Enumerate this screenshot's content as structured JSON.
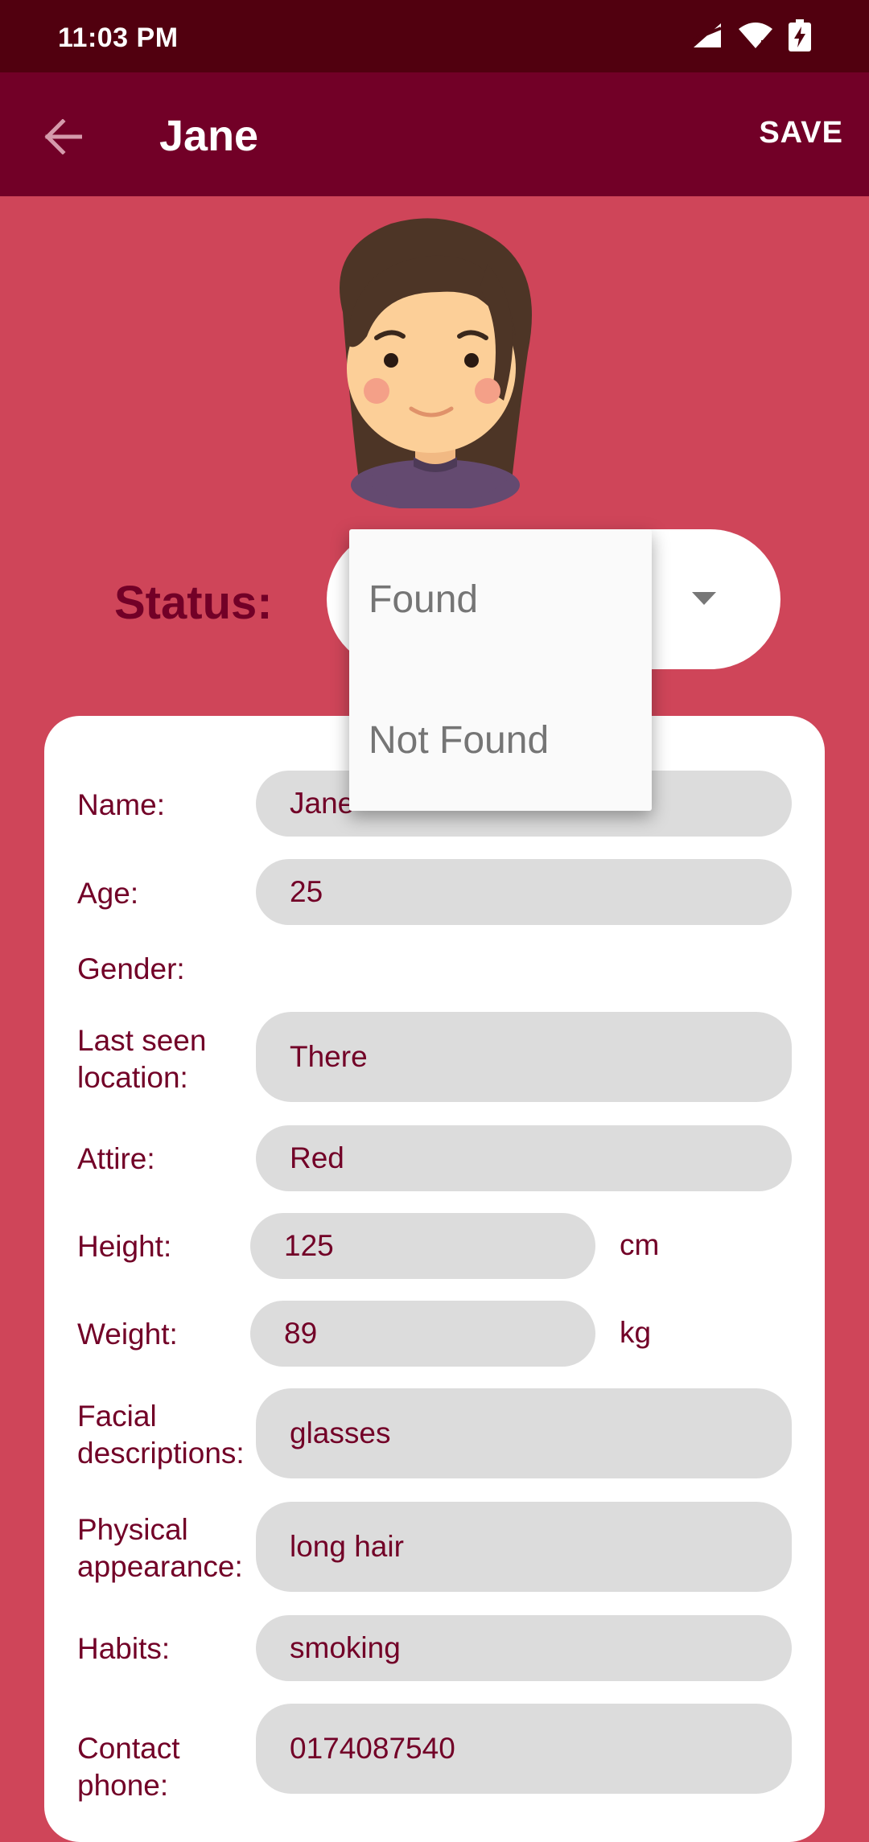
{
  "status_bar": {
    "time": "11:03 PM"
  },
  "app_bar": {
    "title": "Jane",
    "save_label": "SAVE"
  },
  "status": {
    "label": "Status:",
    "selected": "Found",
    "options": [
      "Found",
      "Not Found"
    ]
  },
  "form": {
    "name": {
      "label": "Name:",
      "value": "Jane"
    },
    "age": {
      "label": "Age:",
      "value": "25"
    },
    "gender": {
      "label": "Gender:"
    },
    "last_seen": {
      "label_line1": "Last seen",
      "label_line2": "location:",
      "value": "There"
    },
    "attire": {
      "label": "Attire:",
      "value": "Red"
    },
    "height": {
      "label": "Height:",
      "value": "125",
      "unit": "cm"
    },
    "weight": {
      "label": "Weight:",
      "value": "89",
      "unit": "kg"
    },
    "facial": {
      "label_line1": "Facial",
      "label_line2": "descriptions:",
      "value": "glasses"
    },
    "physical": {
      "label_line1": "Physical",
      "label_line2": "appearance:",
      "value": "long hair"
    },
    "habits": {
      "label": "Habits:",
      "value": "smoking"
    },
    "contact": {
      "label_line1": "Contact",
      "label_line2": "phone:",
      "value": "0174087540"
    }
  },
  "icons": {
    "back": "arrow-left-icon",
    "signal": "signal-icon",
    "wifi": "wifi-icon",
    "battery": "battery-charging-icon",
    "dropdown": "caret-down-icon"
  },
  "colors": {
    "status_bar": "#51000f",
    "app_bar": "#720027",
    "background": "#cf4559",
    "field": "#dcdcdc",
    "text": "#720027"
  }
}
